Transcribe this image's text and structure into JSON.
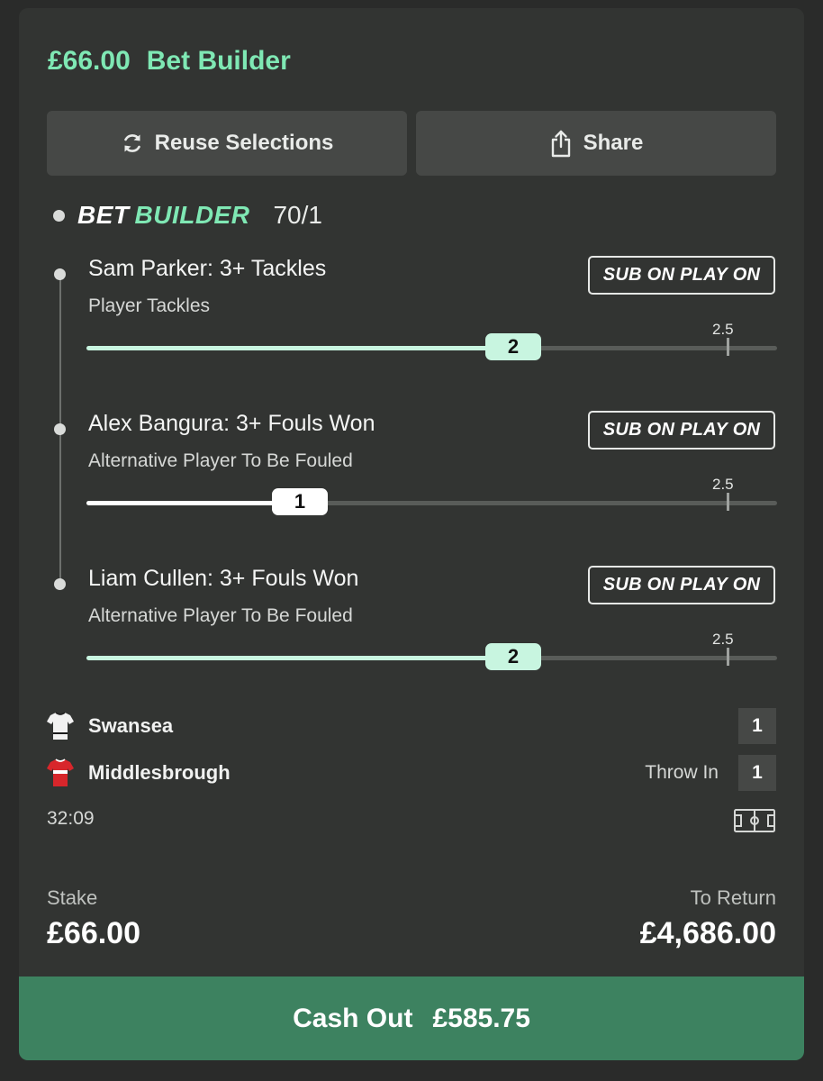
{
  "header": {
    "amount": "£66.00",
    "title": "Bet Builder"
  },
  "actions": {
    "reuse_label": "Reuse Selections",
    "reuse_icon": "refresh-icon",
    "share_label": "Share",
    "share_icon": "share-icon"
  },
  "bet_builder": {
    "logo_word1": "BET",
    "logo_word2": "BUILDER",
    "odds": "70/1"
  },
  "legs": [
    {
      "title": "Sam Parker: 3+ Tackles",
      "subtitle": "Player Tackles",
      "badge": "SUB ON PLAY ON",
      "threshold": "2.5",
      "current": "2",
      "progress": 0.6667,
      "accent": "#c8f5e0"
    },
    {
      "title": "Alex Bangura: 3+ Fouls Won",
      "subtitle": "Alternative Player To Be Fouled",
      "badge": "SUB ON PLAY ON",
      "threshold": "2.5",
      "current": "1",
      "progress": 0.3333,
      "accent": "#ffffff"
    },
    {
      "title": "Liam Cullen: 3+ Fouls Won",
      "subtitle": "Alternative Player To Be Fouled",
      "badge": "SUB ON PLAY ON",
      "threshold": "2.5",
      "current": "2",
      "progress": 0.6667,
      "accent": "#c8f5e0"
    }
  ],
  "match": {
    "home": {
      "name": "Swansea",
      "score": "1",
      "status": "",
      "kit_icon": "white-shirt-icon"
    },
    "away": {
      "name": "Middlesbrough",
      "score": "1",
      "status": "Throw In",
      "kit_icon": "red-shirt-icon"
    },
    "clock": "32:09",
    "pitch_icon": "pitch-icon"
  },
  "stake": {
    "label": "Stake",
    "value": "£66.00"
  },
  "return": {
    "label": "To Return",
    "value": "£4,686.00"
  },
  "cashout": {
    "label": "Cash Out",
    "amount": "£585.75",
    "color": "#3d8260"
  }
}
